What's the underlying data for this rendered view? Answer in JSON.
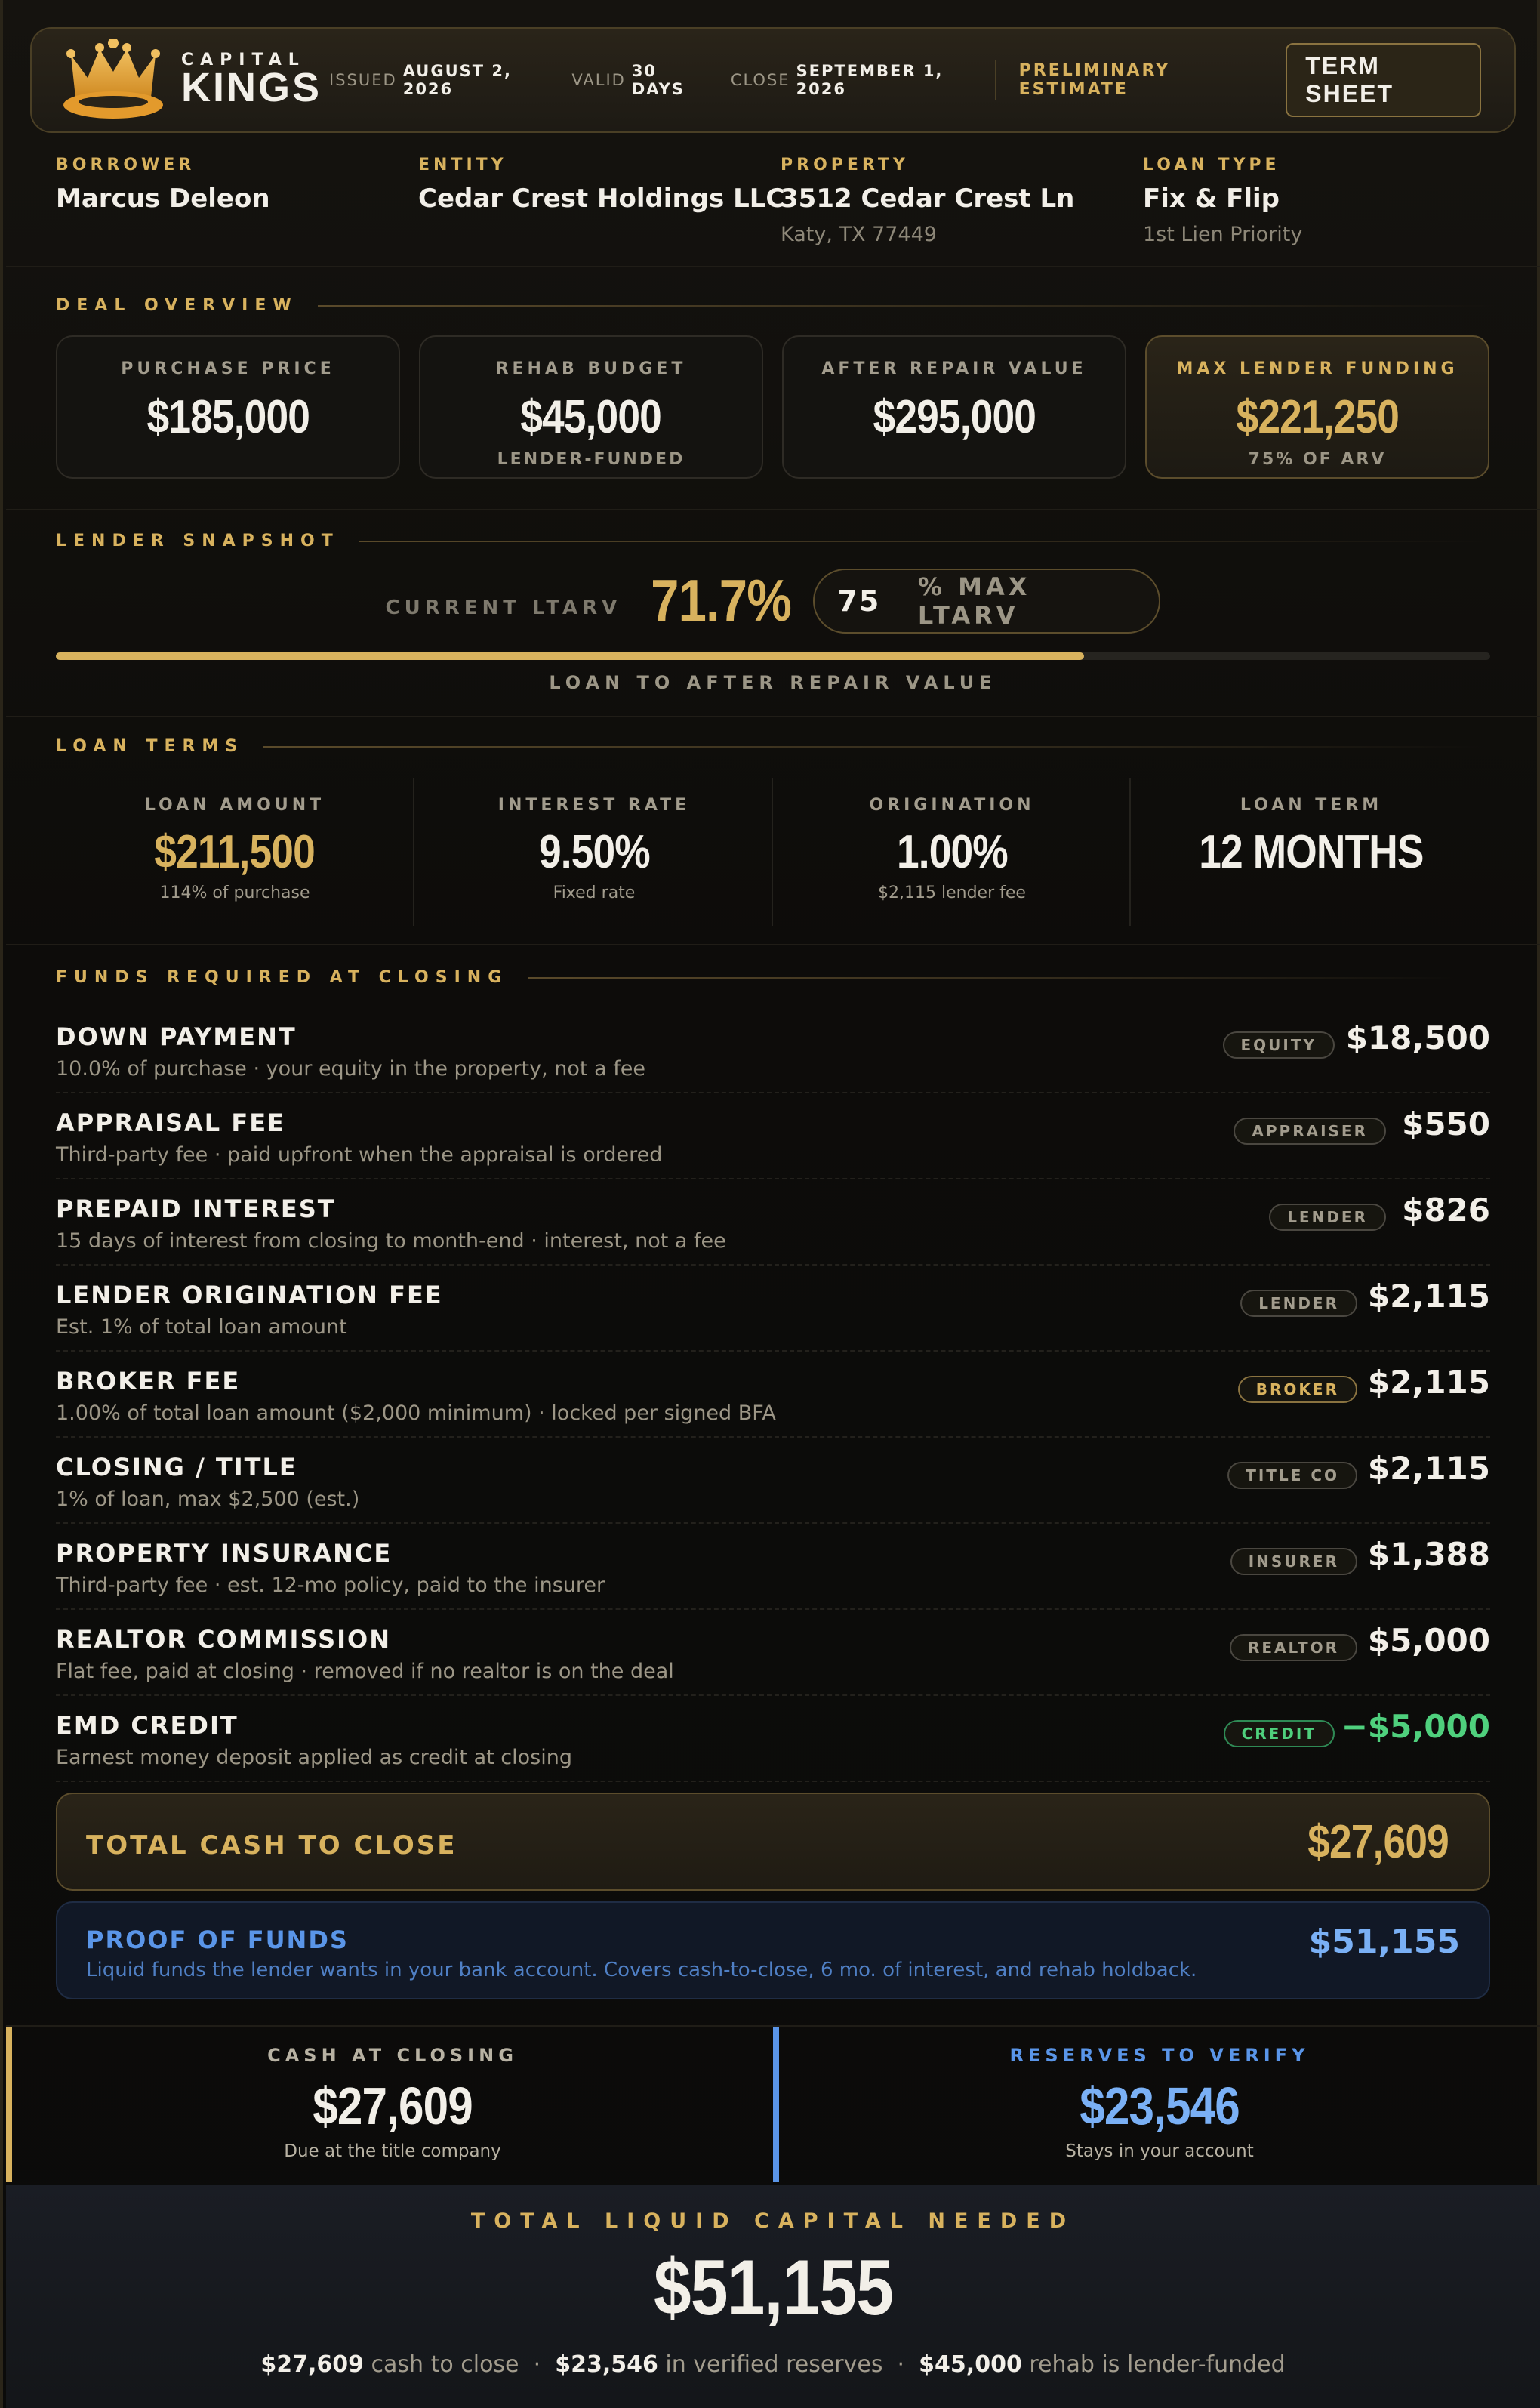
{
  "brand": {
    "line1": "CAPITAL",
    "line2": "KINGS"
  },
  "header": {
    "issued_label": "ISSUED",
    "issued_value": "AUGUST 2, 2026",
    "valid_label": "VALID",
    "valid_value": "30 DAYS",
    "close_label": "CLOSE",
    "close_value": "SEPTEMBER 1, 2026",
    "status": "PRELIMINARY ESTIMATE",
    "term_sheet_button": "TERM SHEET"
  },
  "parties": [
    {
      "label": "BORROWER",
      "value": "Marcus Deleon",
      "sub": ""
    },
    {
      "label": "ENTITY",
      "value": "Cedar Crest Holdings LLC",
      "sub": ""
    },
    {
      "label": "PROPERTY",
      "value": "3512 Cedar Crest Ln",
      "sub": "Katy, TX 77449"
    },
    {
      "label": "LOAN TYPE",
      "value": "Fix & Flip",
      "sub": "1st Lien Priority"
    }
  ],
  "deal_overview": {
    "title": "DEAL OVERVIEW",
    "cards": [
      {
        "label": "PURCHASE PRICE",
        "value": "$185,000",
        "sub": ""
      },
      {
        "label": "REHAB BUDGET",
        "value": "$45,000",
        "sub": "LENDER-FUNDED"
      },
      {
        "label": "AFTER REPAIR VALUE",
        "value": "$295,000",
        "sub": ""
      },
      {
        "label": "MAX LENDER FUNDING",
        "value": "$221,250",
        "sub": "75% OF ARV"
      }
    ]
  },
  "snapshot": {
    "title": "LENDER SNAPSHOT",
    "current_label": "CURRENT LTARV",
    "current_value": "71.7%",
    "current_fraction": 0.717,
    "max_value": "75",
    "max_label": "% MAX LTARV",
    "caption": "LOAN TO AFTER REPAIR VALUE"
  },
  "loan_terms": {
    "title": "LOAN TERMS",
    "items": [
      {
        "label": "LOAN AMOUNT",
        "value": "$211,500",
        "sub": "114% of purchase"
      },
      {
        "label": "INTEREST RATE",
        "value": "9.50%",
        "sub": "Fixed rate"
      },
      {
        "label": "ORIGINATION",
        "value": "1.00%",
        "sub": "$2,115 lender fee"
      },
      {
        "label": "LOAN TERM",
        "value": "12 MONTHS",
        "sub": ""
      }
    ]
  },
  "funds": {
    "title": "FUNDS REQUIRED AT CLOSING",
    "items": [
      {
        "title": "DOWN PAYMENT",
        "sub": "10.0% of purchase · your equity in the property, not a fee",
        "tag": "EQUITY",
        "amount": "$18,500"
      },
      {
        "title": "APPRAISAL FEE",
        "sub": "Third-party fee · paid upfront when the appraisal is ordered",
        "tag": "APPRAISER",
        "amount": "$550"
      },
      {
        "title": "PREPAID INTEREST",
        "sub": "15 days of interest from closing to month-end · interest, not a fee",
        "tag": "LENDER",
        "amount": "$826"
      },
      {
        "title": "LENDER ORIGINATION FEE",
        "sub": "Est. 1% of total loan amount",
        "tag": "LENDER",
        "amount": "$2,115"
      },
      {
        "title": "BROKER FEE",
        "sub": "1.00% of total loan amount ($2,000 minimum) · locked per signed BFA",
        "tag": "BROKER",
        "amount": "$2,115"
      },
      {
        "title": "CLOSING / TITLE",
        "sub": "1% of loan, max $2,500 (est.)",
        "tag": "TITLE CO",
        "amount": "$2,115"
      },
      {
        "title": "PROPERTY INSURANCE",
        "sub": "Third-party fee · est. 12-mo policy, paid to the insurer",
        "tag": "INSURER",
        "amount": "$1,388"
      },
      {
        "title": "REALTOR COMMISSION",
        "sub": "Flat fee, paid at closing · removed if no realtor is on the deal",
        "tag": "REALTOR",
        "amount": "$5,000"
      },
      {
        "title": "EMD CREDIT",
        "sub": "Earnest money deposit applied as credit at closing",
        "tag": "CREDIT",
        "amount": "−$5,000"
      }
    ],
    "total_label": "TOTAL CASH TO CLOSE",
    "total_value": "$27,609"
  },
  "proof_of_funds": {
    "title": "PROOF OF FUNDS",
    "sub": "Liquid funds the lender wants in your bank account. Covers cash-to-close, 6 mo. of interest, and rehab holdback.",
    "value": "$51,155"
  },
  "summary": {
    "cash_label": "CASH AT CLOSING",
    "cash_value": "$27,609",
    "cash_sub": "Due at the title company",
    "reserves_label": "RESERVES TO VERIFY",
    "reserves_value": "$23,546",
    "reserves_sub": "Stays in your account"
  },
  "grand_total": {
    "label": "TOTAL LIQUID CAPITAL NEEDED",
    "value": "$51,155",
    "b1": "$27,609",
    "t1": "cash to close",
    "b2": "$23,546",
    "t2": "in verified reserves",
    "b3": "$45,000",
    "t3": "rehab is lender-funded"
  },
  "colors": {
    "gold": "#d8b25e",
    "blue": "#7ab0f5",
    "green": "#4fd07d"
  }
}
